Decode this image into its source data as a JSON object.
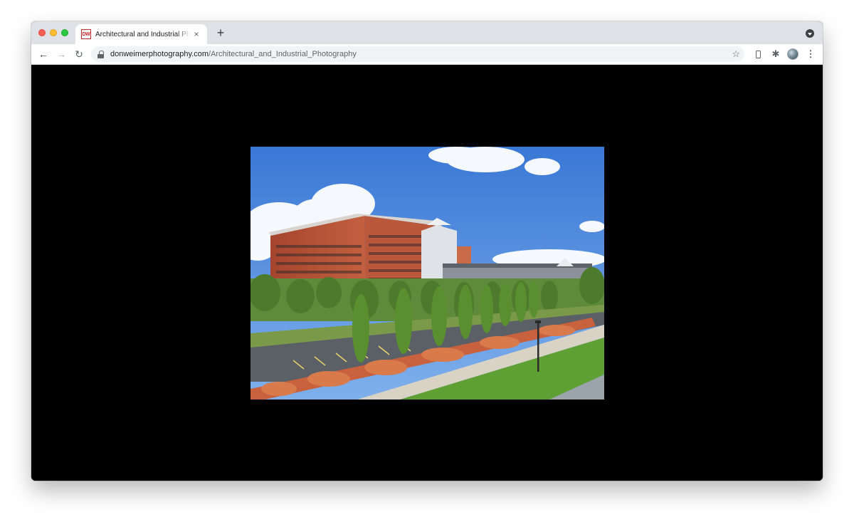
{
  "browser": {
    "tab": {
      "favicon_text": "DW",
      "title": "Architectural and Industrial Photography",
      "close_glyph": "×"
    },
    "new_tab_glyph": "+",
    "toolbar": {
      "back_glyph": "←",
      "forward_glyph": "→",
      "reload_glyph": "↻",
      "url_domain": "donweimerphotography.com",
      "url_path": "/Architectural_and_Industrial_Photography",
      "bookmark_glyph": "☆",
      "extensions_glyph": "✱",
      "menu_glyph": "⋮"
    },
    "icons": {
      "back": "arrow-left-icon",
      "forward": "arrow-right-icon",
      "reload": "reload-icon",
      "lock": "lock-icon",
      "bookmark": "star-icon",
      "device": "phone-icon",
      "extensions": "puzzle-icon",
      "profile": "avatar-icon",
      "menu": "kebab-menu-icon",
      "tab_search": "chevron-down-circle-icon"
    }
  },
  "page": {
    "background": "#000000",
    "photo": {
      "subject": "office-building-photograph"
    }
  }
}
